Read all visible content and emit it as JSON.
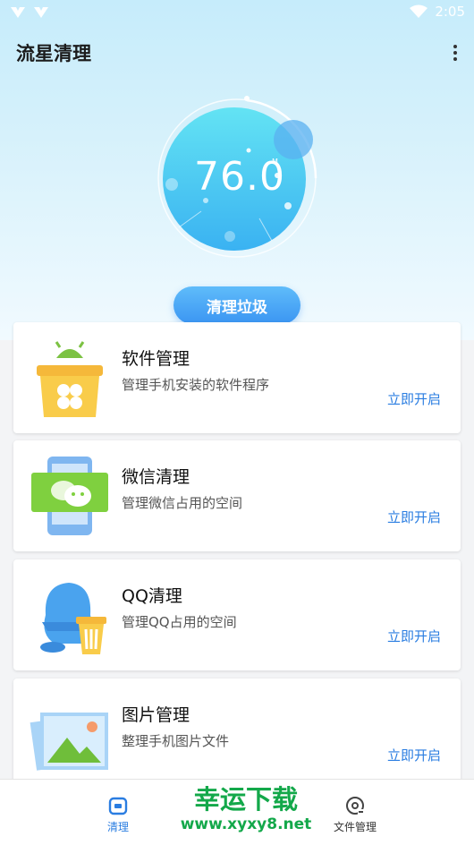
{
  "status_bar": {
    "time": "2:05"
  },
  "app_bar": {
    "title": "流星清理"
  },
  "gauge": {
    "value": "76.0",
    "unit": "M"
  },
  "clean_button": {
    "label": "清理垃圾"
  },
  "cards": [
    {
      "title": "软件管理",
      "desc": "管理手机安装的软件程序",
      "action": "立即开启"
    },
    {
      "title": "微信清理",
      "desc": "管理微信占用的空间",
      "action": "立即开启"
    },
    {
      "title": "QQ清理",
      "desc": "管理QQ占用的空间",
      "action": "立即开启"
    },
    {
      "title": "图片管理",
      "desc": "整理手机图片文件",
      "action": "立即开启"
    }
  ],
  "bottom_nav": {
    "clean": "清理",
    "files": "文件管理"
  },
  "watermark": {
    "line1": "幸运下载",
    "line2": "www.xyxy8.net"
  },
  "colors": {
    "accent": "#2a7de1",
    "gauge": "#36c6f0",
    "watermark": "#13a84a"
  }
}
